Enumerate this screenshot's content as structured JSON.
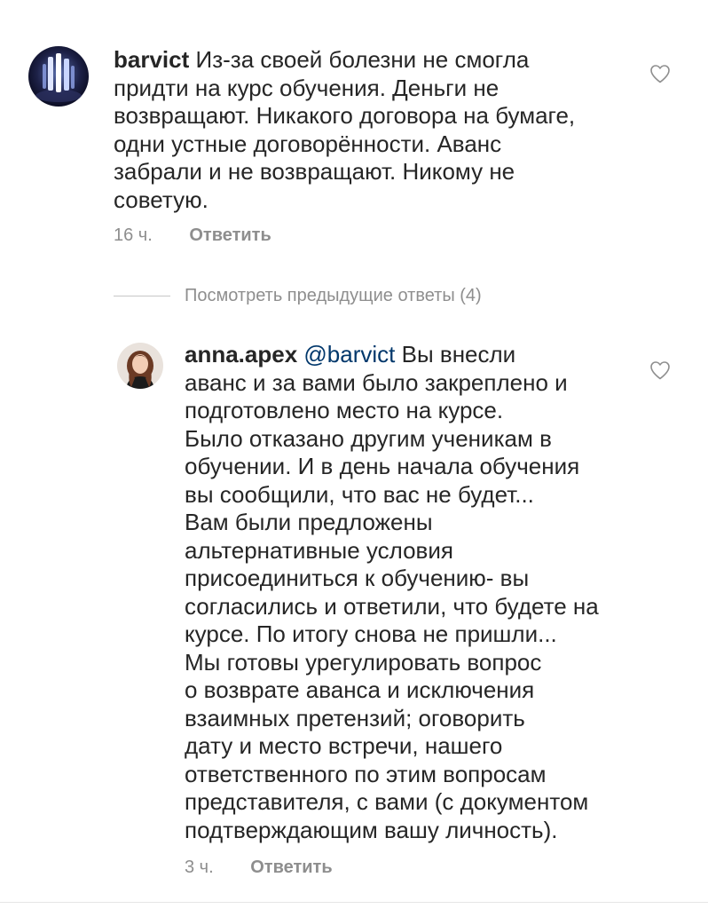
{
  "comments": [
    {
      "username": "barvict",
      "mention": "",
      "lines": [
        "Из-за своей болезни не смогла",
        "придти на курс обучения. Деньги не",
        "возвращают. Никакого договора на бумаге,",
        "одни устные договорённости. Аванс",
        "забрали и не возвращают. Никому не",
        "советую."
      ],
      "time": "16 ч.",
      "reply_label": "Ответить",
      "liked": false
    },
    {
      "username": "anna.apex",
      "mention": "@barvict",
      "lines": [
        "Вы внесли",
        "аванс и за вами было закреплено и",
        "подготовлено место на курсе.",
        "Было отказано другим ученикам в",
        "обучении. И в день начала обучения",
        "вы сообщили, что вас не будет...",
        "Вам были предложены",
        "альтернативные условия",
        "присоединиться к обучению- вы",
        "согласились и ответили, что будете на",
        "курсе. По итогу снова не пришли...",
        "Мы готовы урегулировать вопрос",
        "о возврате аванса и исключения",
        "взаимных претензий; оговорить",
        "дату и место встречи, нашего",
        "ответственного по этим вопросам",
        "представителя, с вами (с документом",
        "подтверждающим вашу личность)."
      ],
      "time": "3 ч.",
      "reply_label": "Ответить",
      "liked": false
    }
  ],
  "view_previous_replies": "Посмотреть предыдущие ответы (4)",
  "colors": {
    "text": "#262626",
    "secondary": "#8e8e8e",
    "mention": "#00376b",
    "divider": "#c7c7c7"
  },
  "icons": {
    "like": "heart-outline-icon"
  }
}
